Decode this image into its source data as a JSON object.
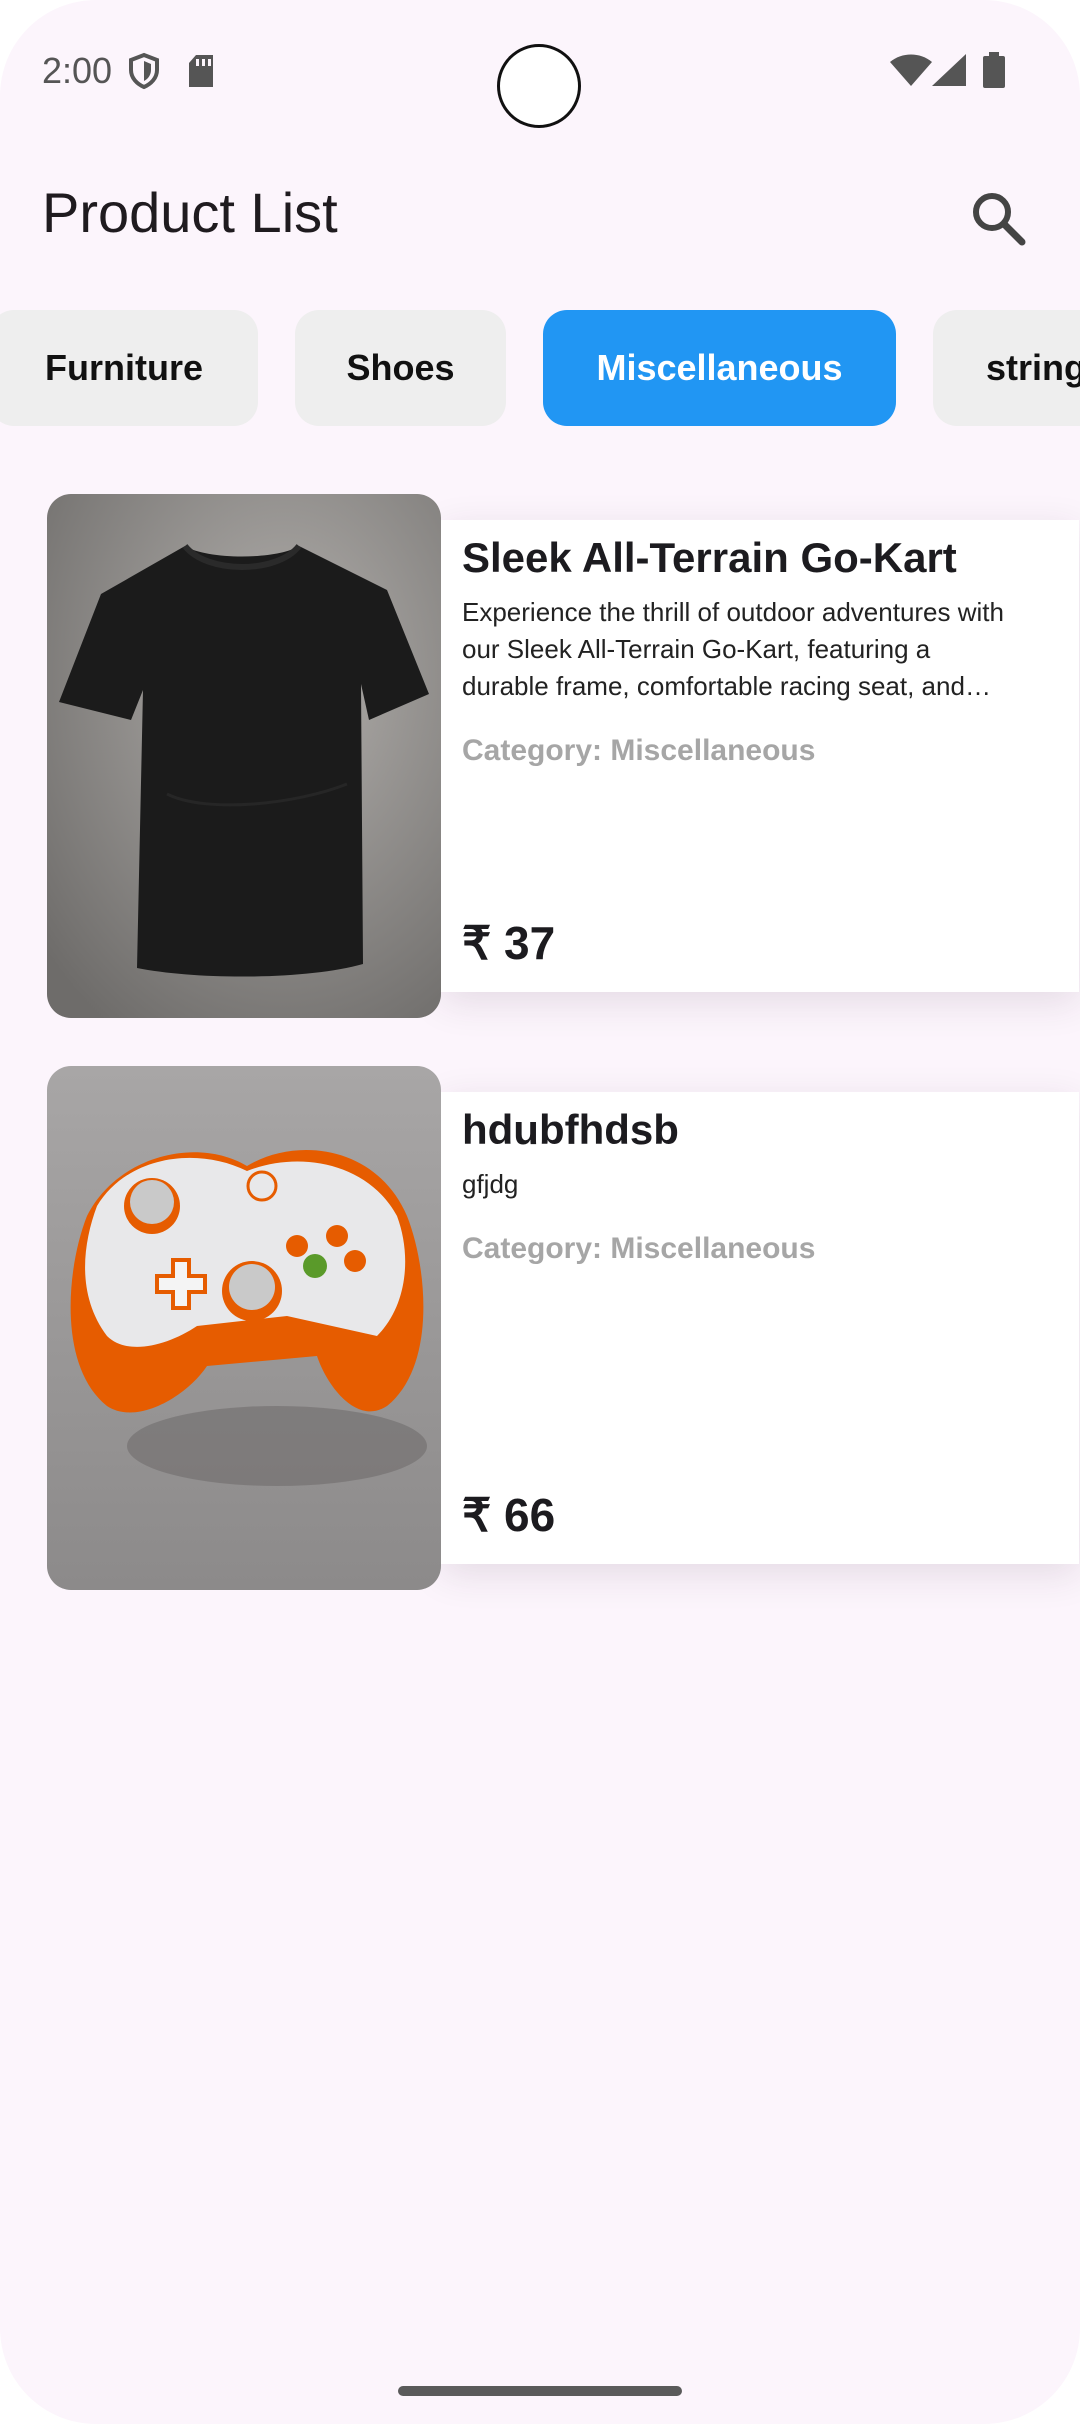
{
  "status_bar": {
    "time": "2:00",
    "icons": [
      "shield-icon",
      "sd-card-icon",
      "wifi-icon",
      "signal-icon",
      "battery-icon"
    ]
  },
  "app_bar": {
    "title": "Product List",
    "search_icon": "search-icon"
  },
  "categories": [
    {
      "label": "Furniture",
      "active": false
    },
    {
      "label": "Shoes",
      "active": false
    },
    {
      "label": "Miscellaneous",
      "active": true
    },
    {
      "label": "string",
      "active": false
    }
  ],
  "products": [
    {
      "title": "Sleek All-Terrain Go-Kart",
      "description": "Experience the thrill of outdoor adventures with our Sleek All-Terrain Go-Kart, featuring a durable frame, comfortable racing seat, and powerful engine.",
      "category": "Category: Miscellaneous",
      "price": "₹ 37",
      "image": "black-tshirt-image"
    },
    {
      "title": "hdubfhdsb",
      "description": "gfjdg",
      "category": "Category: Miscellaneous",
      "price": "₹ 66",
      "image": "game-controller-image"
    }
  ],
  "colors": {
    "background": "#fcf5fc",
    "accent": "#2196f3",
    "chip": "#eeeeee",
    "category_text": "#a6a6a6"
  }
}
